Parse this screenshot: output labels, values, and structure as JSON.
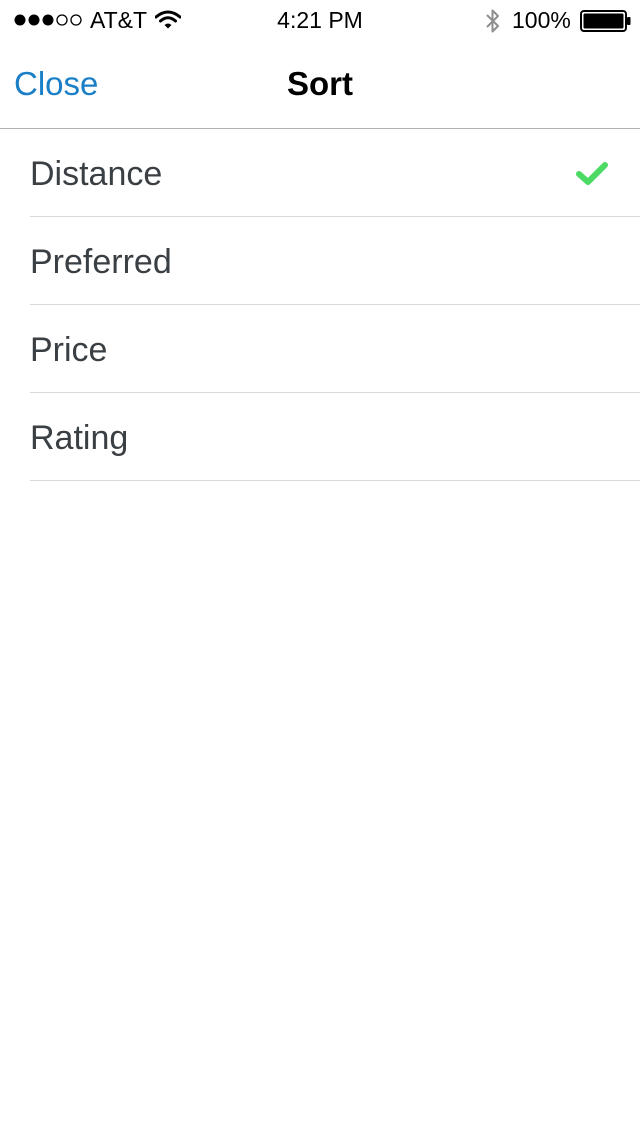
{
  "status_bar": {
    "carrier": "AT&T",
    "time": "4:21 PM",
    "battery": "100%",
    "signal_bars_filled": 3,
    "signal_bars_total": 5,
    "icons": [
      "signal-dots-icon",
      "wifi-icon",
      "bluetooth-icon",
      "battery-icon"
    ]
  },
  "nav": {
    "close_label": "Close",
    "title": "Sort"
  },
  "sort_options": [
    {
      "label": "Distance",
      "selected": true
    },
    {
      "label": "Preferred",
      "selected": false
    },
    {
      "label": "Price",
      "selected": false
    },
    {
      "label": "Rating",
      "selected": false
    }
  ],
  "colors": {
    "accent": "#1a7fc6",
    "check": "#4cd964",
    "separator": "#d9d9d9",
    "text": "#3a3f44"
  }
}
